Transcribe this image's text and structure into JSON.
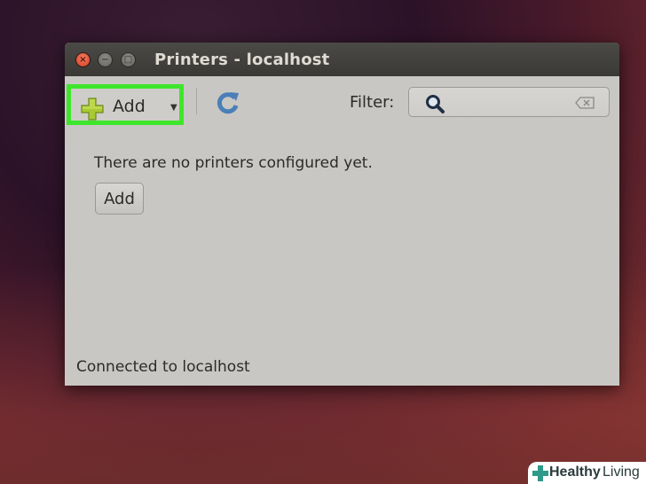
{
  "window": {
    "title": "Printers - localhost",
    "controls": {
      "close_glyph": "×",
      "minimize_glyph": "−",
      "maximize_glyph": "□"
    }
  },
  "toolbar": {
    "add_label": "Add",
    "dropdown_glyph": "▼",
    "filter_label": "Filter:",
    "filter_value": "",
    "icons": [
      "plus-icon",
      "refresh-icon",
      "search-icon",
      "clear-icon"
    ]
  },
  "content": {
    "empty_message": "There are no printers configured yet.",
    "add_button_label": "Add"
  },
  "status": {
    "text": "Connected to localhost"
  },
  "watermark": {
    "brand_bold": "Healthy",
    "brand_regular": "Living"
  },
  "colors": {
    "highlight": "#3ee62b",
    "window_bg": "#c9c7c3",
    "titlebar": "#3f3e3a",
    "close_button": "#e05a3a",
    "refresh_icon": "#4a7fb8",
    "plus_icon": "#a9c934"
  }
}
